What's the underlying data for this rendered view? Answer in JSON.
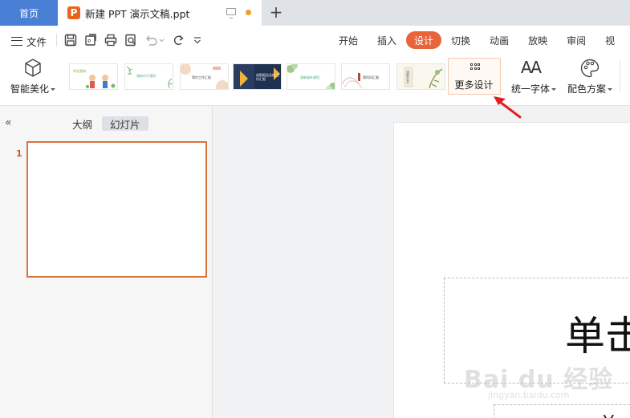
{
  "tabs": {
    "home": "首页",
    "document": "新建 PPT 演示文稿.ppt",
    "logo_letter": "P"
  },
  "toolbar": {
    "file_label": "文件",
    "quick_access_icons": [
      "save-icon",
      "export-icon",
      "print-icon",
      "print-preview-icon",
      "undo-icon",
      "redo-icon",
      "customize-icon"
    ]
  },
  "ribbon_tabs": [
    "开始",
    "插入",
    "设计",
    "切换",
    "动画",
    "放映",
    "审阅",
    "视"
  ],
  "active_ribbon_tab": "设计",
  "design": {
    "smart_beautify": "智能美化",
    "more_design": "更多设计",
    "unify_font": "统一字体",
    "font_glyph": "AA",
    "color_scheme": "配色方案",
    "templates": [
      {
        "text": "毕业答辩"
      },
      {
        "text": "清新叶片通用"
      },
      {
        "text": "简约工作汇报"
      },
      {
        "text": "述职报告总结 工作汇报"
      },
      {
        "text": "清新绿叶通用"
      },
      {
        "text": "简约风汇报"
      },
      {
        "text": "清新文艺"
      }
    ]
  },
  "panel": {
    "outline": "大纲",
    "slides": "幻灯片",
    "slide_number": "1"
  },
  "slide": {
    "title_placeholder": "单击",
    "subtitle_placeholder": "单"
  },
  "watermark": {
    "brand": "Bai du 经验",
    "url": "jingyan.baidu.com"
  },
  "colors": {
    "accent": "#e8643a",
    "home_tab": "#4a7fd6",
    "ppt_logo": "#e8641b",
    "selection_border": "#d6753b",
    "annotation_arrow": "#e02020"
  }
}
